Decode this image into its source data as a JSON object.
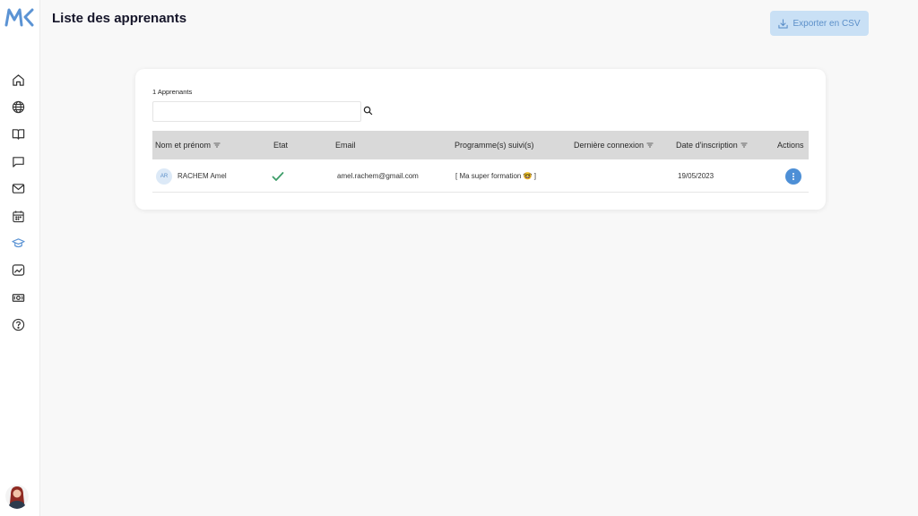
{
  "app": {
    "logo_text": "MK",
    "page_title": "Liste des apprenants",
    "export_label": "Exporter en CSV"
  },
  "sidebar": {
    "items": [
      {
        "icon": "home-icon"
      },
      {
        "icon": "globe-icon"
      },
      {
        "icon": "book-icon"
      },
      {
        "icon": "chat-icon"
      },
      {
        "icon": "mail-icon"
      },
      {
        "icon": "calendar-icon"
      },
      {
        "icon": "graduation-cap-icon",
        "active": true
      },
      {
        "icon": "image-chart-icon"
      },
      {
        "icon": "money-icon"
      },
      {
        "icon": "help-icon"
      }
    ]
  },
  "list": {
    "count_label": "1 Apprenants",
    "search_placeholder": "",
    "columns": [
      {
        "label": "Nom et prénom",
        "filter": true
      },
      {
        "label": "Etat",
        "filter": false
      },
      {
        "label": "Email",
        "filter": false
      },
      {
        "label": "Programme(s) suivi(s)",
        "filter": false
      },
      {
        "label": "Dernière connexion",
        "filter": true
      },
      {
        "label": "Date d'inscription",
        "filter": true
      },
      {
        "label": "Actions",
        "filter": false
      }
    ],
    "rows": [
      {
        "initials": "AR",
        "name": "RACHEM Amel",
        "status": "active",
        "email": "amel.rachem@gmail.com",
        "program": "[ Ma super formation 🤓 ]",
        "last_login": "",
        "registered": "19/05/2023"
      }
    ]
  },
  "colors": {
    "accent": "#4d8fd6",
    "export_bg": "#c9e0f5",
    "status_ok": "#3e9e6a",
    "header_bg": "#d9d9d9"
  }
}
